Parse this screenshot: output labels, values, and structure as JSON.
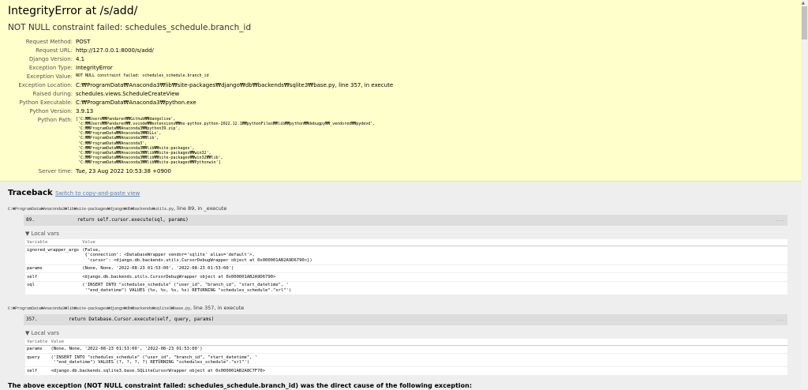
{
  "title": "IntegrityError at /s/add/",
  "subtitle": "NOT NULL constraint failed: schedules_schedule.branch_id",
  "meta": [
    {
      "label": "Request Method:",
      "value": "POST"
    },
    {
      "label": "Request URL:",
      "value": "http://127.0.0.1:8000/s/add/"
    },
    {
      "label": "Django Version:",
      "value": "4.1"
    },
    {
      "label": "Exception Type:",
      "value": "IntegrityError"
    },
    {
      "label": "Exception Value:",
      "value": "NOT NULL constraint failed: schedules_schedule.branch_id"
    },
    {
      "label": "Exception Location:",
      "value": "C:₩ProgramData₩Anaconda3₩lib₩site-packages₩django₩db₩backends₩sqlite3₩base.py, line 357, in execute"
    },
    {
      "label": "Raised during:",
      "value": "schedules.views.ScheduleCreateView"
    },
    {
      "label": "Python Executable:",
      "value": "C:₩ProgramData₩Anaconda3₩python.exe"
    },
    {
      "label": "Python Version:",
      "value": "3.9.13"
    },
    {
      "label": "Python Path:",
      "value": "['C:₩₩Users₩₩Pandaren₩₩Github₩₩dangolive',\n 'c:₩₩Users₩₩Pandaren₩₩.vscode₩₩extensions₩₩ms-python.python-2022.12.1₩₩pythonFiles₩₩lib₩₩python₩₩debugpy₩₩_vendored₩₩pydevd',\n 'C:₩₩ProgramData₩₩Anaconda3₩₩python39.zip',\n 'C:₩₩ProgramData₩₩Anaconda3₩₩DLLs',\n 'C:₩₩ProgramData₩₩Anaconda3₩₩lib',\n 'C:₩₩ProgramData₩₩Anaconda3',\n 'C:₩₩ProgramData₩₩Anaconda3₩₩lib₩₩site-packages',\n 'C:₩₩ProgramData₩₩Anaconda3₩₩lib₩₩site-packages₩₩win32',\n 'C:₩₩ProgramData₩₩Anaconda3₩₩lib₩₩site-packages₩₩win32₩₩lib',\n 'C:₩₩ProgramData₩₩Anaconda3₩₩lib₩₩site-packages₩₩Pythonwin']"
    },
    {
      "label": "Server time:",
      "value": "Tue, 23 Aug 2022 10:53:38 +0900"
    }
  ],
  "traceback": {
    "heading": "Traceback",
    "switch_link": "Switch to copy-and-paste view",
    "frames": [
      {
        "file": "C:₩ProgramData₩Anaconda3₩lib₩site-packages₩django₩db₩backends₩utils.py",
        "loc": ", line 89, in _execute",
        "line_no": "89.",
        "code": "        return self.cursor.execute(sql, params)",
        "dots": "...",
        "local_vars_label": "▼ Local vars",
        "col_var": "Variable",
        "col_val": "Value",
        "vars": [
          {
            "name": "ignored_wrapper_args",
            "value": "(False,\n {'connection': <DatabaseWrapper vendor='sqlite' alias='default'>,\n  'cursor': <django.db.backends.utils.CursorDebugWrapper object at 0x000001AB2A9D6790>})"
          },
          {
            "name": "params",
            "value": "(None, None, '2022-08-23 01:53:00', '2022-08-23 01:53:00')"
          },
          {
            "name": "self",
            "value": "<django.db.backends.utils.CursorDebugWrapper object at 0x000001AB2A9D6790>"
          },
          {
            "name": "sql",
            "value": "('INSERT INTO \"schedules_schedule\" (\"user_id\", \"branch_id\", \"start_datetime\", '\n '\"end_datetime\") VALUES (%s, %s, %s, %s) RETURNING \"schedules_schedule\".\"srl\"')"
          }
        ]
      },
      {
        "file": "C:₩ProgramData₩Anaconda3₩lib₩site-packages₩django₩db₩backends₩sqlite3₩base.py",
        "loc": ", line 357, in execute",
        "line_no": "357.",
        "code": "     return Database.Cursor.execute(self, query, params)",
        "dots": "...",
        "local_vars_label": "▼ Local vars",
        "col_var": "Variable",
        "col_val": "Value",
        "vars": [
          {
            "name": "params",
            "value": "(None, None, '2022-08-23 01:53:00', '2022-08-23 01:53:00')"
          },
          {
            "name": "query",
            "value": "('INSERT INTO \"schedules_schedule\" (\"user_id\", \"branch_id\", \"start_datetime\", '\n '\"end_datetime\") VALUES (?, ?, ?, ?) RETURNING \"schedules_schedule\".\"srl\"')"
          },
          {
            "name": "self",
            "value": "<django.db.backends.sqlite3.base.SQLiteCursorWrapper object at 0x000001AB2A8C7F70>"
          }
        ]
      }
    ]
  },
  "final_text": "The above exception (NOT NULL constraint failed: schedules_schedule.branch_id) was the direct cause of the following exception:"
}
